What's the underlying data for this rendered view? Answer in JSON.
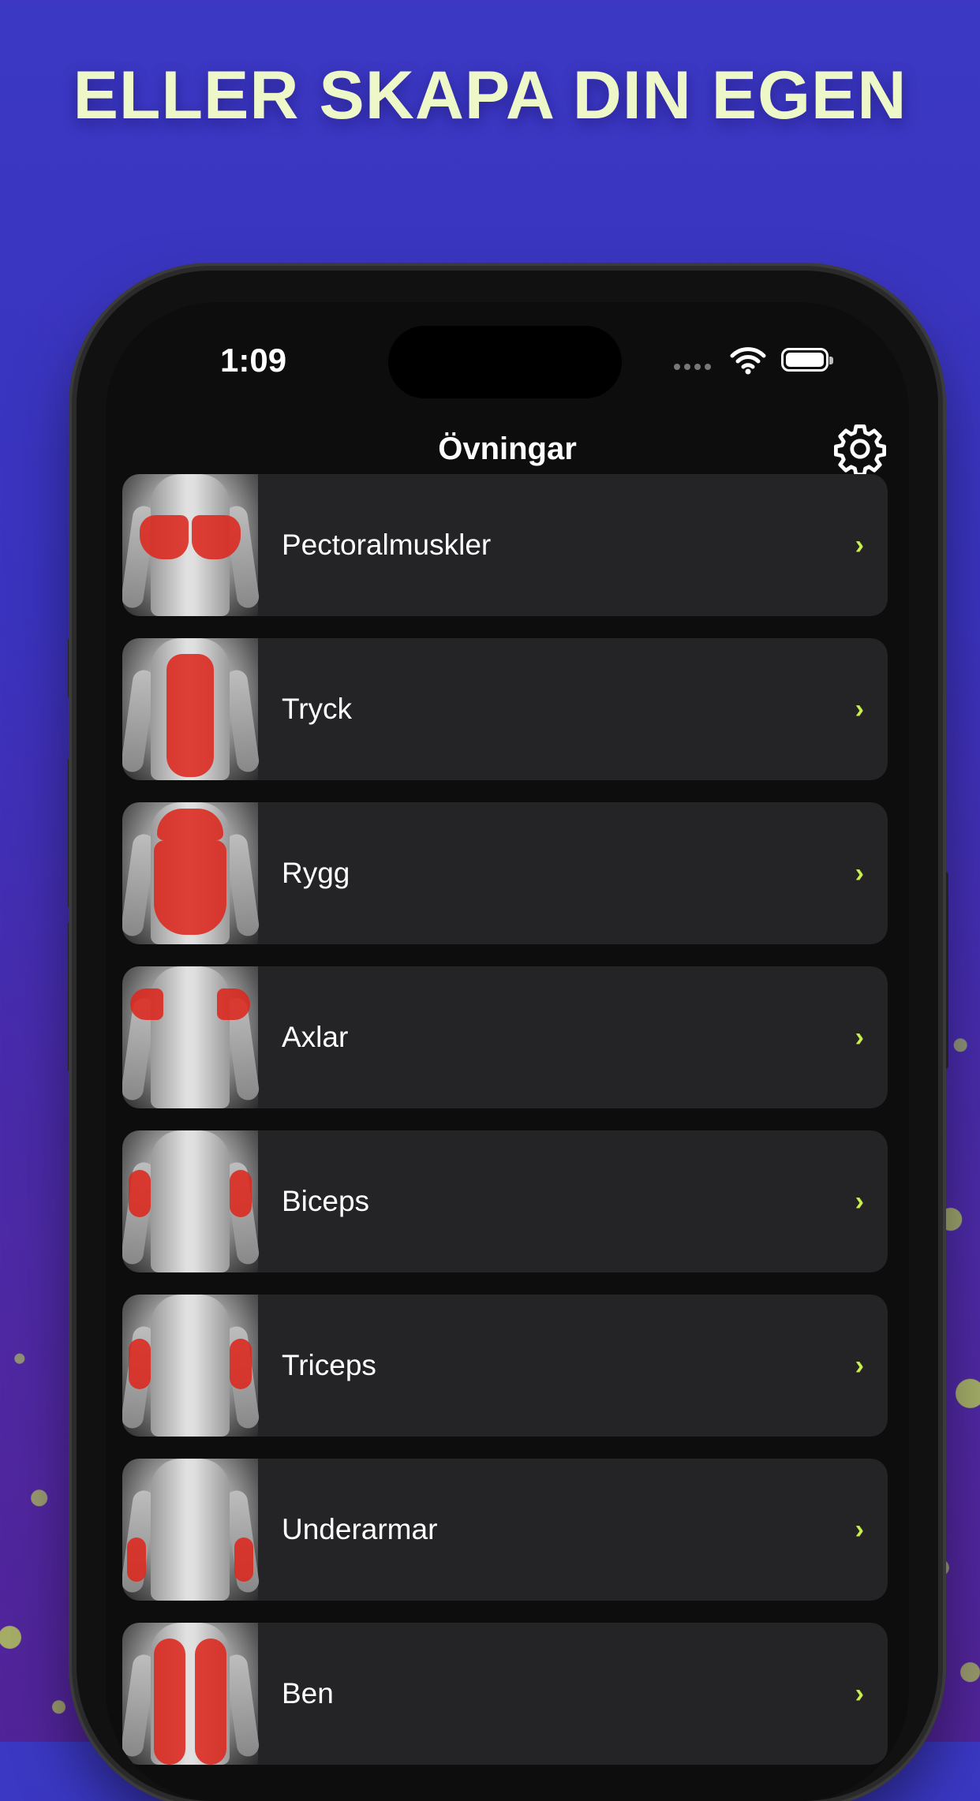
{
  "banner": {
    "headline": "ELLER SKAPA DIN EGEN"
  },
  "status_bar": {
    "time": "1:09"
  },
  "nav": {
    "title": "Övningar",
    "settings_icon": "gear-icon"
  },
  "items": [
    {
      "label": "Pectoralmuskler",
      "highlight": "chest"
    },
    {
      "label": "Tryck",
      "highlight": "abs"
    },
    {
      "label": "Rygg",
      "highlight": "back"
    },
    {
      "label": "Axlar",
      "highlight": "shoulders"
    },
    {
      "label": "Biceps",
      "highlight": "biceps"
    },
    {
      "label": "Triceps",
      "highlight": "triceps"
    },
    {
      "label": "Underarmar",
      "highlight": "forearms"
    },
    {
      "label": "Ben",
      "highlight": "legs"
    }
  ],
  "colors": {
    "accent": "#c7ee4a",
    "background": "#3b38c4",
    "card": "#242426",
    "muscle_highlight": "#dc281e"
  }
}
